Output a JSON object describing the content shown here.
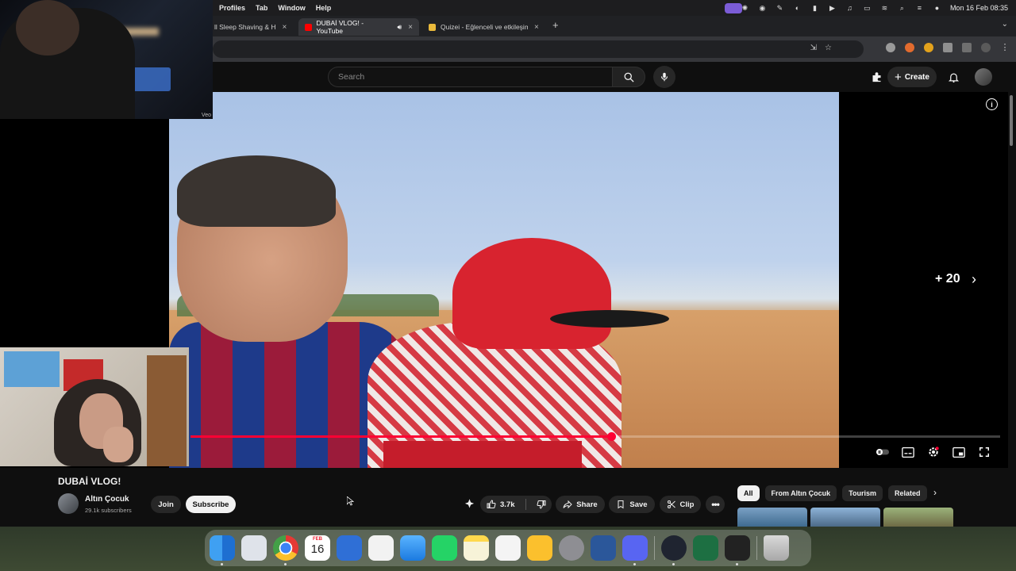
{
  "menubar": {
    "menus": [
      "Profiles",
      "Tab",
      "Window",
      "Help"
    ],
    "clock": "Mon 16 Feb  08:35"
  },
  "tabs": [
    {
      "title": "ll Sleep Shaving & H",
      "active": false
    },
    {
      "title": "DUBAİ VLOG! - YouTube",
      "active": true
    },
    {
      "title": "Quizei - Eğlenceli ve etkileşim",
      "active": false
    }
  ],
  "overlay": {
    "webcam_label": "Veo"
  },
  "youtube": {
    "search_placeholder": "Search",
    "create_label": "Create",
    "skip_label": "+ 20",
    "progress_fraction": 0.52,
    "video": {
      "title": "DUBAİ VLOG!",
      "channel": "Altın Çocuk",
      "subscribers": "29.1k subscribers",
      "join_label": "Join",
      "subscribe_label": "Subscribe",
      "likes": "3.7k",
      "share_label": "Share",
      "save_label": "Save",
      "clip_label": "Clip"
    },
    "chips": [
      "All",
      "From Altın Çocuk",
      "Tourism",
      "Related"
    ]
  },
  "calendar_day": "16",
  "calendar_month": "FEB",
  "colors": {
    "accent_red": "#ff0033",
    "bg": "#0f0f0f",
    "chip_bg": "#272727"
  }
}
